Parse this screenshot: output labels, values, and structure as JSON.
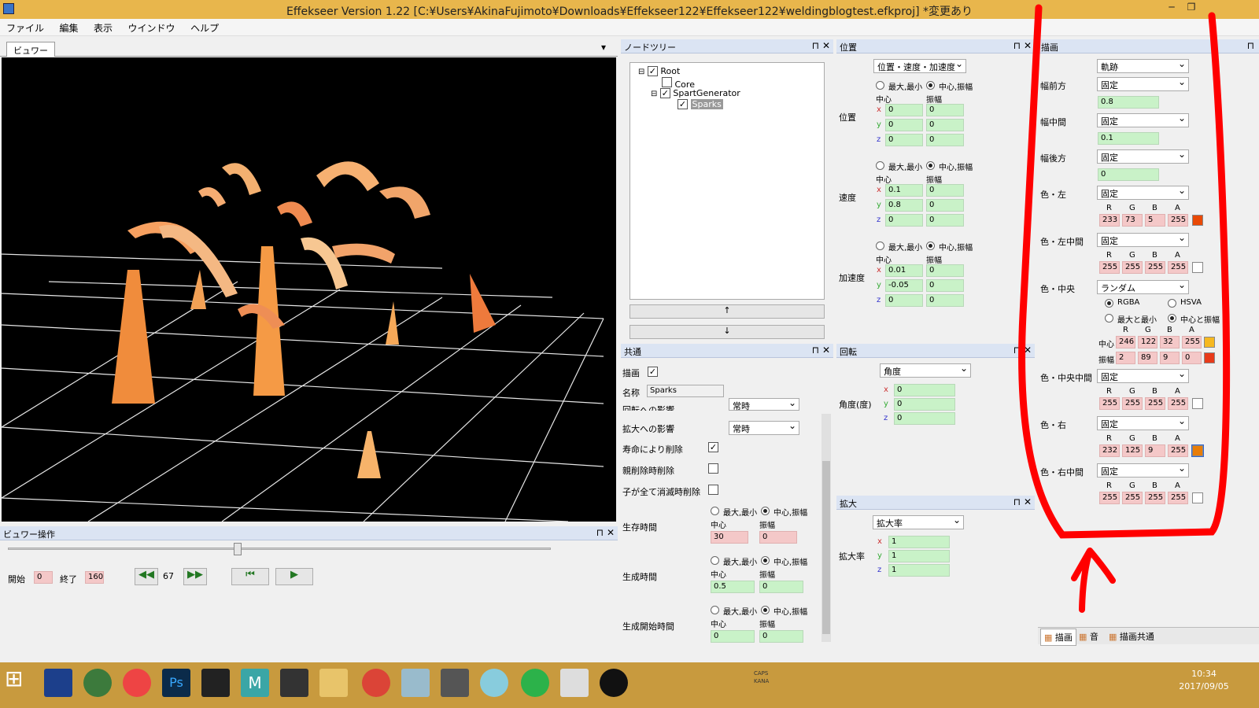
{
  "window": {
    "title": "Effekseer Version 1.22 [C:¥Users¥AkinaFujimoto¥Downloads¥Effekseer122¥Effekseer122¥weldingblogtest.efkproj]  *変更あり",
    "minimize": "─",
    "restore": "❐"
  },
  "menu": [
    "ファイル",
    "編集",
    "表示",
    "ウインドウ",
    "ヘルプ"
  ],
  "viewer": {
    "tab": "ビュワー",
    "dropdown": "▾"
  },
  "viewer_ops": {
    "title": "ビュワー操作",
    "start_label": "開始",
    "start_value": "0",
    "end_label": "終了",
    "end_value": "160",
    "frame": "67",
    "slider_fraction": 0.42
  },
  "node_tree": {
    "title": "ノードツリー",
    "nodes": [
      "Root",
      "Core",
      "SpartGenerator",
      "Sparks"
    ],
    "up": "↑",
    "down": "↓"
  },
  "common": {
    "title": "共通",
    "draw_label": "描画",
    "name_label": "名称",
    "name_value": "Sparks",
    "rot_inherit_label": "回転への影響",
    "rot_inherit_value": "常時",
    "scale_inherit_label": "拡大への影響",
    "scale_inherit_value": "常時",
    "life_delete_label": "寿命により削除",
    "parent_delete_label": "親削除時削除",
    "children_delete_label": "子が全て消滅時削除",
    "life_label": "生存時間",
    "life_center": "30",
    "life_amp": "0",
    "gen_label": "生成時間",
    "gen_center": "0.5",
    "gen_amp": "0",
    "gen_start_label": "生成開始時間",
    "gen_start_center": "0",
    "gen_start_amp": "0",
    "radio_minmax": "最大,最小",
    "radio_center": "中心,振幅",
    "center": "中心",
    "amp": "振幅"
  },
  "position": {
    "title": "位置",
    "mode": "位置・速度・加速度",
    "radio_minmax": "最大,最小",
    "radio_center": "中心,振幅",
    "center": "中心",
    "amp": "振幅",
    "pos_label": "位置",
    "pos": {
      "x": [
        "0",
        "0"
      ],
      "y": [
        "0",
        "0"
      ],
      "z": [
        "0",
        "0"
      ]
    },
    "vel_label": "速度",
    "vel": {
      "x": [
        "0.1",
        "0"
      ],
      "y": [
        "0.8",
        "0"
      ],
      "z": [
        "0",
        "0"
      ]
    },
    "acc_label": "加速度",
    "acc": {
      "x": [
        "0.01",
        "0"
      ],
      "y": [
        "-0.05",
        "0"
      ],
      "z": [
        "0",
        "0"
      ]
    }
  },
  "rotation": {
    "title": "回転",
    "mode": "角度",
    "label": "角度(度)",
    "x": "0",
    "y": "0",
    "z": "0"
  },
  "scale": {
    "title": "拡大",
    "mode": "拡大率",
    "label": "拡大率",
    "x": "1",
    "y": "1",
    "z": "1"
  },
  "draw": {
    "title": "描画",
    "type": "軌跡",
    "front_label": "幅前方",
    "front_mode": "固定",
    "front_value": "0.8",
    "middle_label": "幅中間",
    "middle_mode": "固定",
    "middle_value": "0.1",
    "back_label": "幅後方",
    "back_mode": "固定",
    "back_value": "0",
    "c_left_label": "色・左",
    "c_left_mode": "固定",
    "c_left": [
      "233",
      "73",
      "5",
      "255"
    ],
    "c_left_swatch": "#e94905",
    "c_leftmid_label": "色・左中間",
    "c_leftmid_mode": "固定",
    "c_leftmid": [
      "255",
      "255",
      "255",
      "255"
    ],
    "c_center_label": "色・中央",
    "c_center_mode": "ランダム",
    "rgba": "RGBA",
    "hsva": "HSVA",
    "minmax": "最大と最小",
    "centeramp": "中心と振幅",
    "center_label": "中心",
    "c_center": [
      "246",
      "122",
      "32",
      "255"
    ],
    "c_center_swatch": "#f6b820",
    "amp_label": "振幅",
    "c_amp": [
      "2",
      "89",
      "9",
      "0"
    ],
    "c_amp_swatch": "#e83a1a",
    "c_centermid_label": "色・中央中間",
    "c_centermid_mode": "固定",
    "c_centermid": [
      "255",
      "255",
      "255",
      "255"
    ],
    "c_right_label": "色・右",
    "c_right_mode": "固定",
    "c_right": [
      "232",
      "125",
      "9",
      "255"
    ],
    "c_right_swatch": "#e87d09",
    "c_rightmid_label": "色・右中間",
    "c_rightmid_mode": "固定",
    "c_rightmid": [
      "255",
      "255",
      "255",
      "255"
    ],
    "rgba_headers": [
      "R",
      "G",
      "B",
      "A"
    ]
  },
  "bottom_tabs": [
    "描画",
    "音",
    "描画共通"
  ],
  "taskbar": {
    "time": "10:34",
    "date": "2017/09/05",
    "caps": "CAPS",
    "kana": "KANA"
  },
  "colors": {
    "annotation": "#ff0000",
    "taskbar": "#c89a3e",
    "field_green": "#c9f2c8",
    "field_red": "#f4c8c8"
  }
}
